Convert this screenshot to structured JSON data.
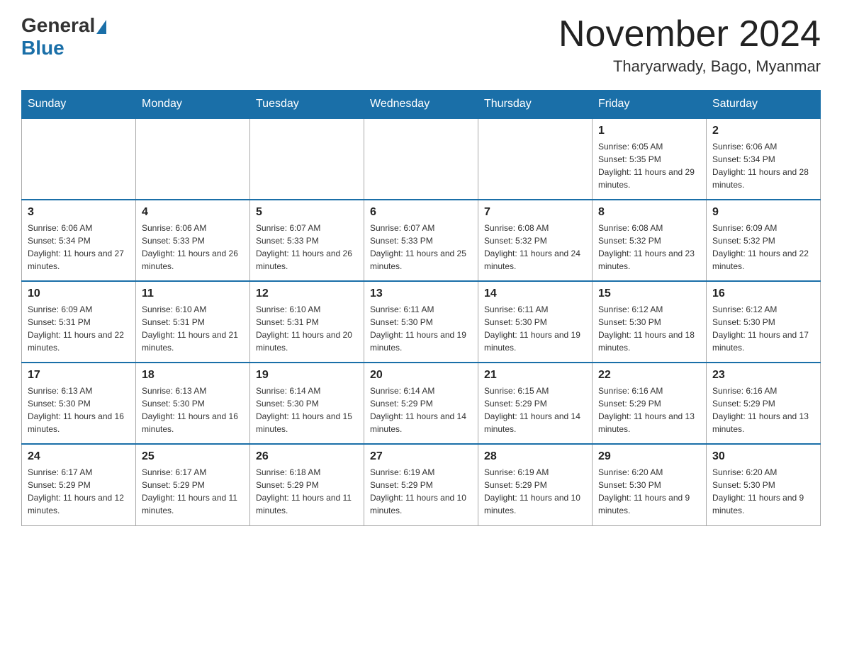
{
  "header": {
    "logo_general": "General",
    "logo_blue": "Blue",
    "month_title": "November 2024",
    "location": "Tharyarwady, Bago, Myanmar"
  },
  "weekdays": [
    "Sunday",
    "Monday",
    "Tuesday",
    "Wednesday",
    "Thursday",
    "Friday",
    "Saturday"
  ],
  "weeks": [
    [
      {
        "day": "",
        "info": ""
      },
      {
        "day": "",
        "info": ""
      },
      {
        "day": "",
        "info": ""
      },
      {
        "day": "",
        "info": ""
      },
      {
        "day": "",
        "info": ""
      },
      {
        "day": "1",
        "info": "Sunrise: 6:05 AM\nSunset: 5:35 PM\nDaylight: 11 hours and 29 minutes."
      },
      {
        "day": "2",
        "info": "Sunrise: 6:06 AM\nSunset: 5:34 PM\nDaylight: 11 hours and 28 minutes."
      }
    ],
    [
      {
        "day": "3",
        "info": "Sunrise: 6:06 AM\nSunset: 5:34 PM\nDaylight: 11 hours and 27 minutes."
      },
      {
        "day": "4",
        "info": "Sunrise: 6:06 AM\nSunset: 5:33 PM\nDaylight: 11 hours and 26 minutes."
      },
      {
        "day": "5",
        "info": "Sunrise: 6:07 AM\nSunset: 5:33 PM\nDaylight: 11 hours and 26 minutes."
      },
      {
        "day": "6",
        "info": "Sunrise: 6:07 AM\nSunset: 5:33 PM\nDaylight: 11 hours and 25 minutes."
      },
      {
        "day": "7",
        "info": "Sunrise: 6:08 AM\nSunset: 5:32 PM\nDaylight: 11 hours and 24 minutes."
      },
      {
        "day": "8",
        "info": "Sunrise: 6:08 AM\nSunset: 5:32 PM\nDaylight: 11 hours and 23 minutes."
      },
      {
        "day": "9",
        "info": "Sunrise: 6:09 AM\nSunset: 5:32 PM\nDaylight: 11 hours and 22 minutes."
      }
    ],
    [
      {
        "day": "10",
        "info": "Sunrise: 6:09 AM\nSunset: 5:31 PM\nDaylight: 11 hours and 22 minutes."
      },
      {
        "day": "11",
        "info": "Sunrise: 6:10 AM\nSunset: 5:31 PM\nDaylight: 11 hours and 21 minutes."
      },
      {
        "day": "12",
        "info": "Sunrise: 6:10 AM\nSunset: 5:31 PM\nDaylight: 11 hours and 20 minutes."
      },
      {
        "day": "13",
        "info": "Sunrise: 6:11 AM\nSunset: 5:30 PM\nDaylight: 11 hours and 19 minutes."
      },
      {
        "day": "14",
        "info": "Sunrise: 6:11 AM\nSunset: 5:30 PM\nDaylight: 11 hours and 19 minutes."
      },
      {
        "day": "15",
        "info": "Sunrise: 6:12 AM\nSunset: 5:30 PM\nDaylight: 11 hours and 18 minutes."
      },
      {
        "day": "16",
        "info": "Sunrise: 6:12 AM\nSunset: 5:30 PM\nDaylight: 11 hours and 17 minutes."
      }
    ],
    [
      {
        "day": "17",
        "info": "Sunrise: 6:13 AM\nSunset: 5:30 PM\nDaylight: 11 hours and 16 minutes."
      },
      {
        "day": "18",
        "info": "Sunrise: 6:13 AM\nSunset: 5:30 PM\nDaylight: 11 hours and 16 minutes."
      },
      {
        "day": "19",
        "info": "Sunrise: 6:14 AM\nSunset: 5:30 PM\nDaylight: 11 hours and 15 minutes."
      },
      {
        "day": "20",
        "info": "Sunrise: 6:14 AM\nSunset: 5:29 PM\nDaylight: 11 hours and 14 minutes."
      },
      {
        "day": "21",
        "info": "Sunrise: 6:15 AM\nSunset: 5:29 PM\nDaylight: 11 hours and 14 minutes."
      },
      {
        "day": "22",
        "info": "Sunrise: 6:16 AM\nSunset: 5:29 PM\nDaylight: 11 hours and 13 minutes."
      },
      {
        "day": "23",
        "info": "Sunrise: 6:16 AM\nSunset: 5:29 PM\nDaylight: 11 hours and 13 minutes."
      }
    ],
    [
      {
        "day": "24",
        "info": "Sunrise: 6:17 AM\nSunset: 5:29 PM\nDaylight: 11 hours and 12 minutes."
      },
      {
        "day": "25",
        "info": "Sunrise: 6:17 AM\nSunset: 5:29 PM\nDaylight: 11 hours and 11 minutes."
      },
      {
        "day": "26",
        "info": "Sunrise: 6:18 AM\nSunset: 5:29 PM\nDaylight: 11 hours and 11 minutes."
      },
      {
        "day": "27",
        "info": "Sunrise: 6:19 AM\nSunset: 5:29 PM\nDaylight: 11 hours and 10 minutes."
      },
      {
        "day": "28",
        "info": "Sunrise: 6:19 AM\nSunset: 5:29 PM\nDaylight: 11 hours and 10 minutes."
      },
      {
        "day": "29",
        "info": "Sunrise: 6:20 AM\nSunset: 5:30 PM\nDaylight: 11 hours and 9 minutes."
      },
      {
        "day": "30",
        "info": "Sunrise: 6:20 AM\nSunset: 5:30 PM\nDaylight: 11 hours and 9 minutes."
      }
    ]
  ]
}
